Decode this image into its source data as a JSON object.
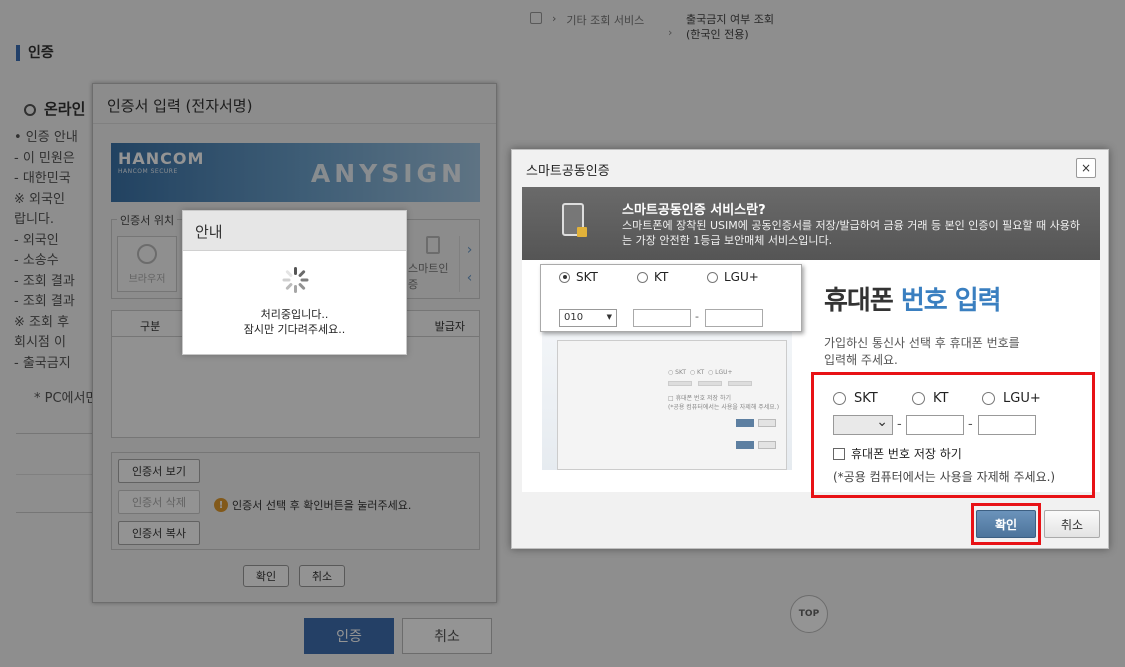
{
  "background": {
    "breadcrumb": {
      "item1": "기타 조회 서비스",
      "current_line1": "출국금지 여부 조회",
      "current_line2": "(한국인 전용)"
    },
    "page_title": "인증",
    "section_title": "온라인",
    "list_items": [
      "• 인증 안내",
      "  - 이 민원은",
      "  - 대한민국",
      "    ※ 외국인",
      "    랍니다.",
      "    - 외국인",
      "    - 소송수",
      "  - 조회 결과",
      "  - 조회 결과",
      "    ※ 조회 후",
      "    회시점 이",
      "  - 출국금지"
    ],
    "note": "* PC에서만",
    "auth_button": "인증",
    "cancel_button": "취소",
    "top_button": "TOP"
  },
  "cert_dialog": {
    "title": "인증서 입력 (전자서명)",
    "banner_brand": "HANCOM",
    "banner_brand_sub": "HANCOM SECURE",
    "banner_product": "ANYSIGN",
    "location_label": "인증서 위치",
    "loc_browser": "브라우저",
    "loc_smart": "스마트인증",
    "col_gubun": "구분",
    "col_issuer": "발급자",
    "btn_view": "인증서 보기",
    "btn_delete": "인증서 삭제",
    "btn_copy": "인증서 복사",
    "info_msg": "인증서 선택 후 확인버튼을 눌러주세요.",
    "btn_ok": "확인",
    "btn_cancel": "취소"
  },
  "loading": {
    "title": "안내",
    "line1": "처리중입니다..",
    "line2": "잠시만 기다려주세요.."
  },
  "smart_dialog": {
    "title": "스마트공동인증",
    "close": "×",
    "intro_title": "스마트공동인증 서비스란?",
    "intro_desc": "스마트폰에 장착된 USIM에 공동인증서를 저장/발급하여 금융 거래 등 본인 인증이 필요할 때 사용하는 가장 안전한 1등급 보안매체 서비스입니다.",
    "heading_part1": "휴대폰 ",
    "heading_part2": "번호 입력",
    "desc_line1": "가입하신 통신사 선택 후 휴대폰 번호를",
    "desc_line2": "입력해 주세요.",
    "carriers": [
      "SKT",
      "KT",
      "LGU+"
    ],
    "zoom_prefix": "010",
    "save_label": "휴대폰 번호 저장 하기",
    "public_note": "(*공용 컴퓨터에서는 사용을 자제해 주세요.)",
    "btn_ok": "확인",
    "btn_cancel": "취소",
    "accent_color": "#3a7fc0",
    "highlight_color": "#e81216"
  }
}
